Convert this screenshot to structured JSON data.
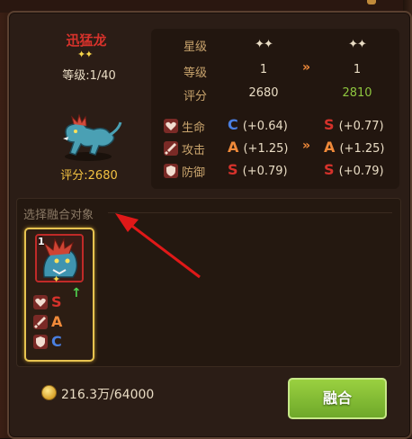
{
  "hero": {
    "name": "迅猛龙",
    "stars": "✦✦",
    "level_text": "等级:1/40",
    "score_text": "评分:2680"
  },
  "compare": {
    "rows": [
      {
        "label": "星级",
        "before": "✦✦",
        "after": "✦✦"
      },
      {
        "label": "等级",
        "before": "1",
        "after": "1"
      },
      {
        "label": "评分",
        "before": "2680",
        "after": "2810"
      }
    ],
    "arrow": "»",
    "attrs": [
      {
        "icon": "heart-icon",
        "label": "生命",
        "before_grade": "C",
        "before_val": "(+0.64)",
        "after_grade": "S",
        "after_val": "(+0.77)"
      },
      {
        "icon": "sword-icon",
        "label": "攻击",
        "before_grade": "A",
        "before_val": "(+1.25)",
        "after_grade": "A",
        "after_val": "(+1.25)"
      },
      {
        "icon": "shield-icon",
        "label": "防御",
        "before_grade": "S",
        "before_val": "(+0.79)",
        "after_grade": "S",
        "after_val": "(+0.79)"
      }
    ]
  },
  "select": {
    "title": "选择融合对象",
    "card": {
      "level": "1",
      "star": "✦",
      "grades": [
        "S",
        "A",
        "C"
      ]
    }
  },
  "footer": {
    "cost": "216.3万/64000",
    "fuse_label": "融合"
  },
  "colors": {
    "grade_S": "#d6322b",
    "grade_A": "#f08a3a",
    "grade_C": "#4a7fe0",
    "improved": "#8ec63f",
    "button": "#8cc63a"
  }
}
